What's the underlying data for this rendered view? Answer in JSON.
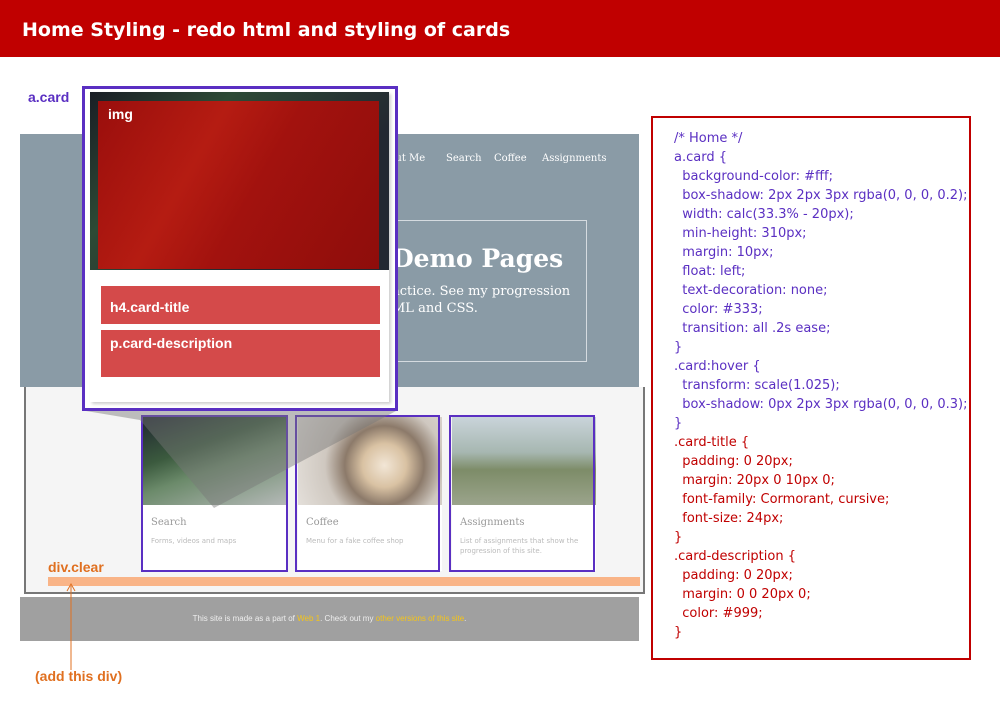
{
  "header": {
    "title": "Home Styling - redo html and styling of cards"
  },
  "mock_site": {
    "nav_items": [
      "bout Me",
      "Search",
      "Coffee",
      "Assignments"
    ],
    "hero_title": "Demo Pages",
    "hero_text_1": "actice. See my progression",
    "hero_text_2": "ML and CSS."
  },
  "cards": [
    {
      "title": "Search",
      "description": "Forms, videos and maps"
    },
    {
      "title": "Coffee",
      "description": "Menu for a fake coffee shop"
    },
    {
      "title": "Assignments",
      "description": "List of assignments that show the progression of this site."
    }
  ],
  "callout": {
    "label": "a.card",
    "img_label": "img",
    "title_label": "h4.card-title",
    "desc_label": "p.card-description",
    "behind_desc_fragment": "maps"
  },
  "clear": {
    "label": "div.clear",
    "note": "(add this div)"
  },
  "footer": {
    "text_before": "This site is made as a part of ",
    "link_1": "Web 1",
    "text_middle": ". Check out my ",
    "link_2": "other versions of this site",
    "text_after": "."
  },
  "code_lines": [
    "/* Home */",
    "a.card {",
    "  background-color: #fff;",
    "  box-shadow: 2px 2px 3px rgba(0, 0, 0, 0.2);",
    "  width: calc(33.3% - 20px);",
    "  min-height: 310px;",
    "  margin: 10px;",
    "  float: left;",
    "  text-decoration: none;",
    "  color: #333;",
    "  transition: all .2s ease;",
    "}",
    ".card:hover {",
    "  transform: scale(1.025);",
    "  box-shadow: 0px 2px 3px rgba(0, 0, 0, 0.3);",
    "}",
    ".card-title {",
    "  padding: 0 20px;",
    "  margin: 20px 0 10px 0;",
    "  font-family: Cormorant, cursive;",
    "  font-size: 24px;",
    "}",
    ".card-description {",
    "  padding: 0 20px;",
    "  margin: 0 0 20px 0;",
    "  color: #999;",
    "}"
  ],
  "colors": {
    "header_red": "#c00000",
    "annotation_purple": "#5a2fc2",
    "annotation_orange": "#e07020",
    "clear_bar": "#f9b487",
    "hero_gray_blue": "#8a9ba6"
  }
}
